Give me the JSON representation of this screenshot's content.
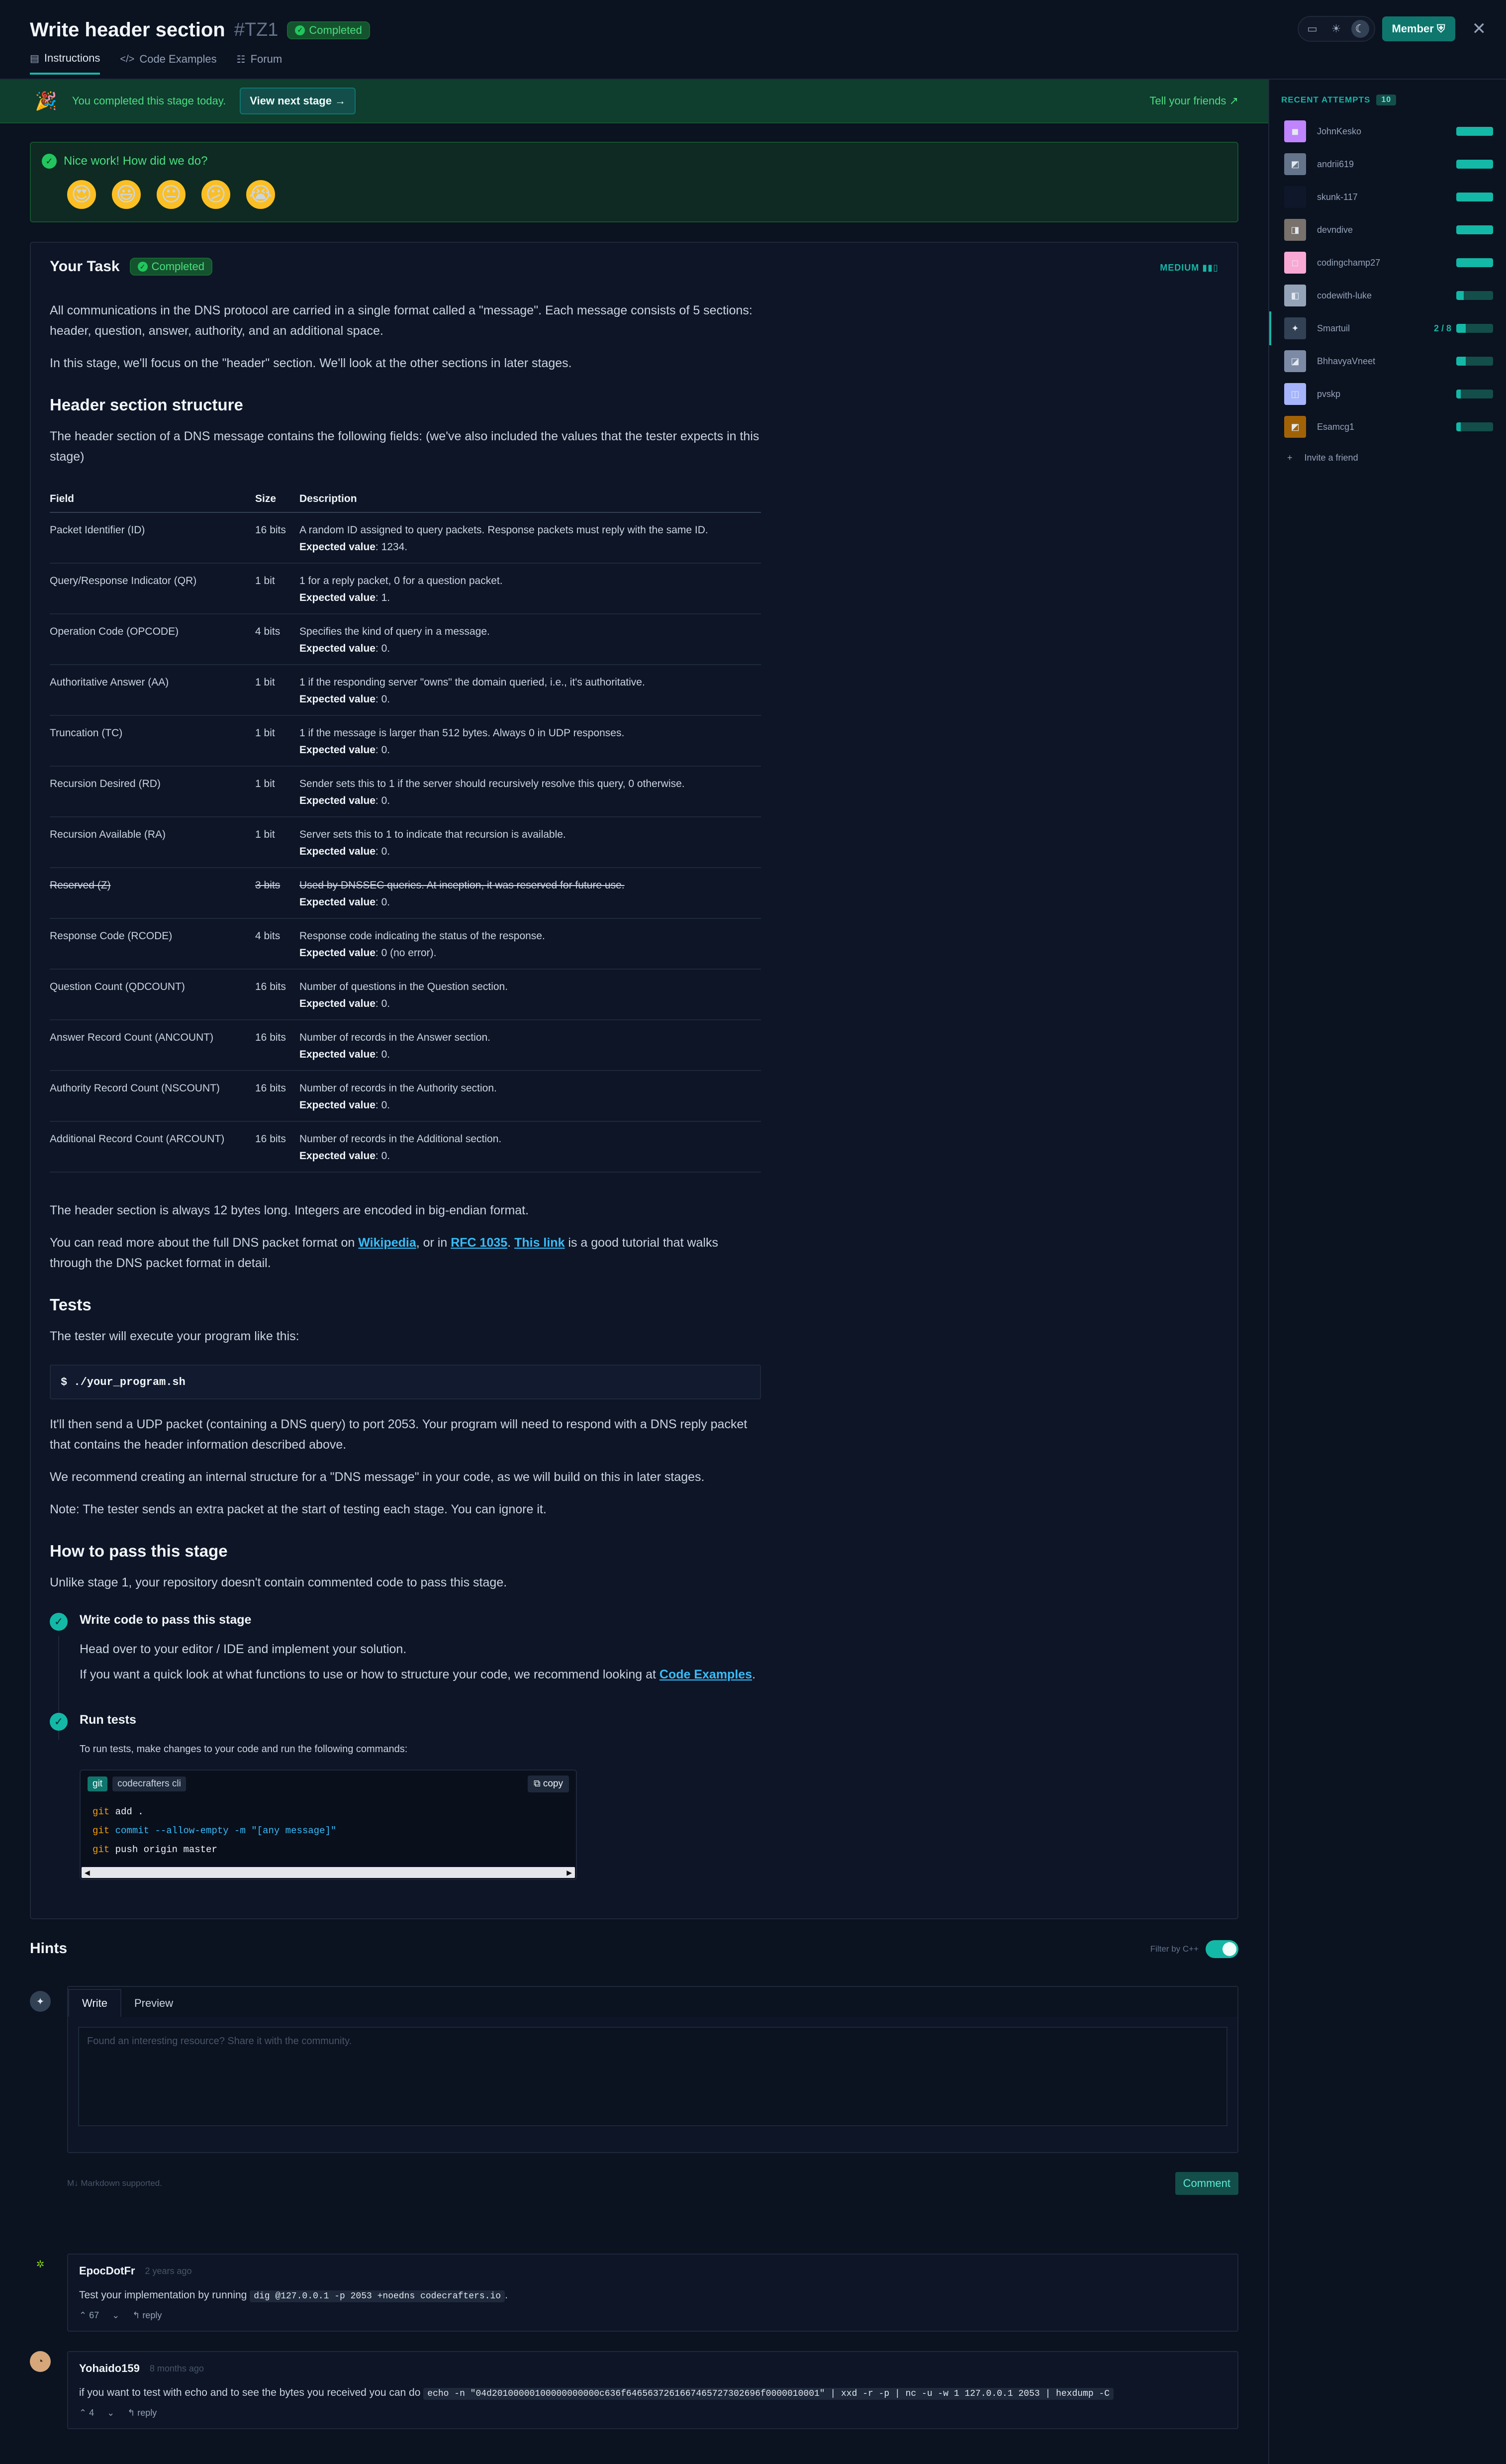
{
  "header": {
    "title": "Write header section",
    "stage_id": "#TZ1",
    "status": "Completed",
    "tabs": [
      {
        "label": "Instructions",
        "icon": "document-icon"
      },
      {
        "label": "Code Examples",
        "icon": "code-icon"
      },
      {
        "label": "Forum",
        "icon": "chat-icon"
      }
    ],
    "member_label": "Member"
  },
  "banner": {
    "text": "You completed this stage today.",
    "next_label": "View next stage →",
    "tell_label": "Tell your friends"
  },
  "feedback": {
    "question": "Nice work! How did we do?",
    "emojis": [
      "😍",
      "😃",
      "😐",
      "😕",
      "😭"
    ]
  },
  "task": {
    "title": "Your Task",
    "status": "Completed",
    "difficulty": "MEDIUM",
    "intro_1": "All communications in the DNS protocol are carried in a single format called a \"message\". Each message consists of 5 sections: header, question, answer, authority, and an additional space.",
    "intro_2": "In this stage, we'll focus on the \"header\" section. We'll look at the other sections in later stages.",
    "h_structure": "Header section structure",
    "structure_text": "The header section of a DNS message contains the following fields: (we've also included the values that the tester expects in this stage)",
    "columns": [
      "Field",
      "Size",
      "Description"
    ],
    "rows": [
      {
        "field": "Packet Identifier (ID)",
        "size": "16 bits",
        "desc": "A random ID assigned to query packets. Response packets must reply with the same ID.",
        "ev_label": "Expected value",
        "ev": ": 1234."
      },
      {
        "field": "Query/Response Indicator (QR)",
        "size": "1 bit",
        "desc": "1 for a reply packet, 0 for a question packet.",
        "ev_label": "Expected value",
        "ev": ": 1."
      },
      {
        "field": "Operation Code (OPCODE)",
        "size": "4 bits",
        "desc": "Specifies the kind of query in a message.",
        "ev_label": "Expected value",
        "ev": ": 0."
      },
      {
        "field": "Authoritative Answer (AA)",
        "size": "1 bit",
        "desc": "1 if the responding server \"owns\" the domain queried, i.e., it's authoritative.",
        "ev_label": "Expected value",
        "ev": ": 0."
      },
      {
        "field": "Truncation (TC)",
        "size": "1 bit",
        "desc": "1 if the message is larger than 512 bytes. Always 0 in UDP responses.",
        "ev_label": "Expected value",
        "ev": ": 0."
      },
      {
        "field": "Recursion Desired (RD)",
        "size": "1 bit",
        "desc": "Sender sets this to 1 if the server should recursively resolve this query, 0 otherwise.",
        "ev_label": "Expected value",
        "ev": ": 0."
      },
      {
        "field": "Recursion Available (RA)",
        "size": "1 bit",
        "desc": "Server sets this to 1 to indicate that recursion is available.",
        "ev_label": "Expected value",
        "ev": ": 0."
      },
      {
        "field": "Reserved (Z)",
        "size": "3 bits",
        "desc": "Used by DNSSEC queries. At inception, it was reserved for future use.",
        "ev_label": "Expected value",
        "ev": ": 0."
      },
      {
        "field": "Response Code (RCODE)",
        "size": "4 bits",
        "desc": "Response code indicating the status of the response.",
        "ev_label": "Expected value",
        "ev": ": 0 (no error)."
      },
      {
        "field": "Question Count (QDCOUNT)",
        "size": "16 bits",
        "desc": "Number of questions in the Question section.",
        "ev_label": "Expected value",
        "ev": ": 0."
      },
      {
        "field": "Answer Record Count (ANCOUNT)",
        "size": "16 bits",
        "desc": "Number of records in the Answer section.",
        "ev_label": "Expected value",
        "ev": ": 0."
      },
      {
        "field": "Authority Record Count (NSCOUNT)",
        "size": "16 bits",
        "desc": "Number of records in the Authority section.",
        "ev_label": "Expected value",
        "ev": ": 0."
      },
      {
        "field": "Additional Record Count (ARCOUNT)",
        "size": "16 bits",
        "desc": "Number of records in the Additional section.",
        "ev_label": "Expected value",
        "ev": ": 0."
      }
    ],
    "after_table": "The header section is always 12 bytes long. Integers are encoded in big-endian format.",
    "read_more_pre": "You can read more about the full DNS packet format on ",
    "link_wikipedia": "Wikipedia",
    "read_more_mid": ", or in ",
    "link_rfc": "RFC 1035",
    "read_more_mid2": ". ",
    "link_this": "This link",
    "read_more_post": " is a good tutorial that walks through the DNS packet format in detail.",
    "h_tests": "Tests",
    "tests_text": "The tester will execute your program like this:",
    "command": "$ ./your_program.sh",
    "tests_2": "It'll then send a UDP packet (containing a DNS query) to port 2053. Your program will need to respond with a DNS reply packet that contains the header information described above.",
    "tests_3": "We recommend creating an internal structure for a \"DNS message\" in your code, as we will build on this in later stages.",
    "tests_4": "Note: The tester sends an extra packet at the start of testing each stage. You can ignore it.",
    "h_pass": "How to pass this stage",
    "pass_text": "Unlike stage 1, your repository doesn't contain commented code to pass this stage.",
    "step1_title": "Write code to pass this stage",
    "step1_text": "Head over to your editor / IDE and implement your solution.",
    "step1_text2_pre": "If you want a quick look at what functions to use or how to structure your code, we recommend looking at ",
    "step1_link": "Code Examples",
    "step1_text2_post": ".",
    "step2_title": "Run tests",
    "step2_text": "To run tests, make changes to your code and run the following commands:",
    "code_tab_git": "git",
    "code_tab_cli": "codecrafters cli",
    "copy_label": "copy",
    "code_lines": [
      {
        "cmd": "git",
        "rest": " add ."
      },
      {
        "cmd": "git",
        "rest": " commit --allow-empty -m \"[any message]\""
      },
      {
        "cmd": "git",
        "rest": " push origin master"
      }
    ]
  },
  "hints": {
    "title": "Hints",
    "filter_label": "Filter by C++",
    "write_tab": "Write",
    "preview_tab": "Preview",
    "placeholder": "Found an interesting resource? Share it with the community.",
    "markdown_note": "Markdown supported.",
    "comment_label": "Comment",
    "items": [
      {
        "user": "EpocDotFr",
        "time": "2 years ago",
        "text_pre": "Test your implementation by running ",
        "code": "dig @127.0.0.1 -p 2053 +noedns codecrafters.io",
        "text_post": ".",
        "votes": "67",
        "reply": "reply"
      },
      {
        "user": "Yohaido159",
        "time": "8 months ago",
        "text_pre": "if you want to test with echo and to see the bytes you received you can do ",
        "code": "echo -n \"04d20100000100000000000c636f6465637261667465727302696f0000010001\" | xxd -r -p | nc -u -w 1 127.0.0.1 2053 | hexdump -C",
        "text_post": "",
        "votes": "4",
        "reply": "reply"
      }
    ]
  },
  "sidebar": {
    "heading": "RECENT ATTEMPTS",
    "count": "10",
    "attempts": [
      {
        "name": "JohnKesko",
        "progress": "",
        "fill": 1.0
      },
      {
        "name": "andrii619",
        "progress": "",
        "fill": 1.0
      },
      {
        "name": "skunk-117",
        "progress": "",
        "fill": 1.0
      },
      {
        "name": "devndive",
        "progress": "",
        "fill": 1.0
      },
      {
        "name": "codingchamp27",
        "progress": "",
        "fill": 1.0
      },
      {
        "name": "codewith-luke",
        "progress": "",
        "fill": 0.2
      },
      {
        "name": "Smartuil",
        "progress": "2 / 8",
        "fill": 0.25
      },
      {
        "name": "BhhavyaVneet",
        "progress": "",
        "fill": 0.25
      },
      {
        "name": "pvskp",
        "progress": "",
        "fill": 0.12
      },
      {
        "name": "Esamcg1",
        "progress": "",
        "fill": 0.12
      }
    ],
    "invite": "Invite a friend"
  }
}
